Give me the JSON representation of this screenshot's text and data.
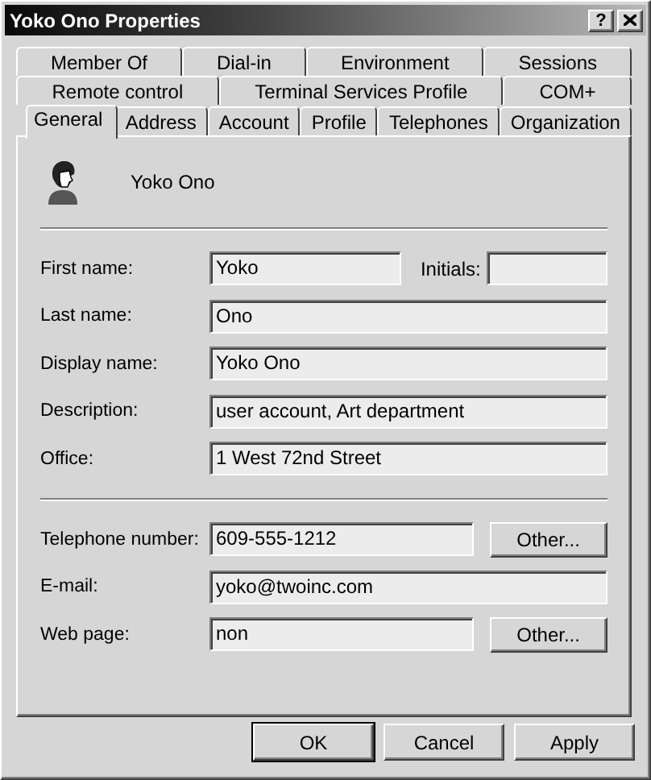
{
  "window": {
    "title": "Yoko Ono Properties",
    "help": "?"
  },
  "tab_rows": [
    {
      "tabs": [
        {
          "label": "Member Of",
          "selected": false
        },
        {
          "label": "Dial-in",
          "selected": false
        },
        {
          "label": "Environment",
          "selected": false
        },
        {
          "label": "Sessions",
          "selected": false
        }
      ]
    },
    {
      "tabs": [
        {
          "label": "Remote control",
          "selected": false
        },
        {
          "label": "Terminal Services Profile",
          "selected": false
        },
        {
          "label": "COM+",
          "selected": false
        }
      ]
    },
    {
      "tabs": [
        {
          "label": "General",
          "selected": true
        },
        {
          "label": "Address",
          "selected": false
        },
        {
          "label": "Account",
          "selected": false
        },
        {
          "label": "Profile",
          "selected": false
        },
        {
          "label": "Telephones",
          "selected": false
        },
        {
          "label": "Organization",
          "selected": false
        }
      ]
    }
  ],
  "user": {
    "name": "Yoko Ono"
  },
  "field_groups": [
    {
      "fields": [
        {
          "kind": "with_extra",
          "label": "First name:",
          "value": "Yoko",
          "extra_label": "Initials:"
        },
        {
          "kind": "text",
          "label": "Last name:",
          "value": "Ono"
        },
        {
          "kind": "text",
          "label": "Display name:",
          "value": "Yoko Ono"
        },
        {
          "kind": "text",
          "label": "Description:",
          "value": "user account, Art department"
        },
        {
          "kind": "text",
          "label": "Office:",
          "value": "1 West 72nd Street"
        }
      ]
    },
    {
      "fields": [
        {
          "kind": "with_button",
          "label": "Telephone number:",
          "value": "609-555-1212",
          "button": "Other..."
        },
        {
          "kind": "text",
          "label": "E-mail:",
          "value": "yoko@twoinc.com"
        },
        {
          "kind": "with_button",
          "label": "Web page:",
          "value": "non",
          "button": "Other..."
        }
      ]
    }
  ],
  "buttons": [
    {
      "label": "OK",
      "default": true
    },
    {
      "label": "Cancel",
      "default": false
    },
    {
      "label": "Apply",
      "default": false
    }
  ]
}
